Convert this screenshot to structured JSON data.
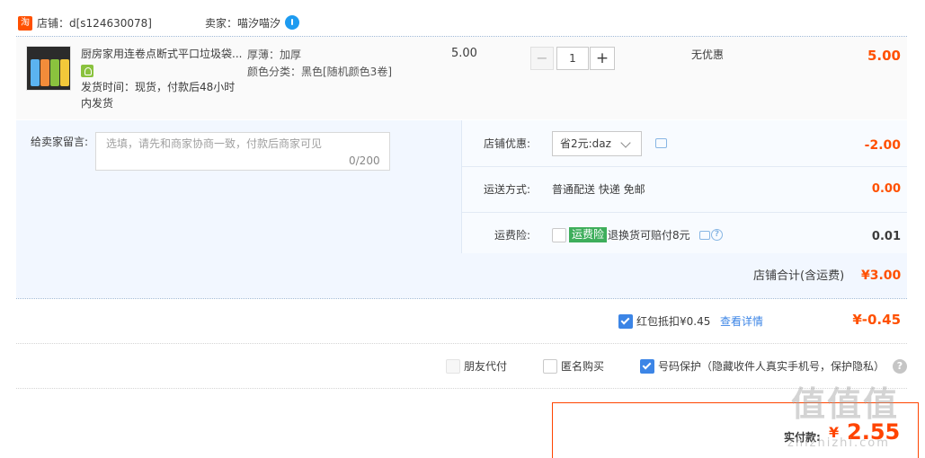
{
  "shop": {
    "badge": "淘",
    "name": "店铺：d[s124630078]",
    "seller": "卖家：喵汐喵汐"
  },
  "item": {
    "title": "厨房家用连卷点断式平口垃圾袋...",
    "ship_time": "发货时间：现货，付款后48小时内发货",
    "spec_thickness": "厚薄：加厚",
    "spec_color": "颜色分类：黑色[随机颜色3卷]",
    "unit_price": "5.00",
    "qty_minus": "−",
    "qty": "1",
    "qty_plus": "+",
    "discount_text": "无优惠",
    "total": "5.00"
  },
  "message": {
    "label": "给卖家留言:",
    "placeholder": "选填，请先和商家协商一致，付款后商家可见",
    "count": "0/200"
  },
  "shop_discount": {
    "label": "店铺优惠:",
    "selected": "省2元:daz",
    "amount": "-2.00"
  },
  "shipping": {
    "label": "运送方式:",
    "value": "普通配送 快递 免邮",
    "amount": "0.00"
  },
  "insurance": {
    "label": "运费险:",
    "badge": "运费险",
    "text": "退换货可赔付8元",
    "help": "?",
    "amount": "0.01"
  },
  "shop_total": {
    "label": "店铺合计(含运费)",
    "amount": "¥3.00"
  },
  "red_packet": {
    "text": "红包抵扣¥0.45",
    "link": "查看详情",
    "amount": "¥-0.45",
    "checked": true
  },
  "options": {
    "friend_pay": "朋友代付",
    "anonymous": "匿名购买",
    "privacy": "号码保护（隐藏收件人真实手机号，保护隐私）",
    "help": "?"
  },
  "payment": {
    "label": "实付款:",
    "yen": "¥",
    "amount": "2.55"
  },
  "watermark": {
    "main": "值值值",
    "sub": "zhizhizhi.com"
  },
  "colors": {
    "accent": "#ff5000",
    "link": "#3c85e6",
    "insurance_badge": "#3eae5b",
    "panel_bg": "#f2f7ff"
  }
}
